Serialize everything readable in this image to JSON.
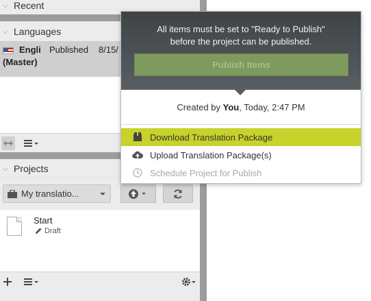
{
  "sections": {
    "recent": "Recent",
    "languages": "Languages",
    "projects": "Projects"
  },
  "language_row": {
    "name": "Engli",
    "master": "(Master)",
    "status": "Published",
    "date": "8/15/"
  },
  "projects_panel": {
    "filter_label": "My translatio..."
  },
  "project_item": {
    "name": "Start",
    "status": "Draft"
  },
  "popover": {
    "message_line1": "All items must be set to \"Ready to Publish\"",
    "message_line2": "before the project can be published.",
    "publish_button": "Publish Items",
    "created_prefix": "Created by ",
    "created_user": "You",
    "created_suffix": ", Today, 2:47 PM",
    "menu": [
      {
        "label": "Download Translation Package"
      },
      {
        "label": "Upload Translation Package(s)"
      },
      {
        "label": "Schedule Project for Publish"
      }
    ]
  },
  "colors": {
    "highlight": "#c7d22a",
    "publish_button": "#7f9a5f",
    "popover_header": "#4a4f52"
  },
  "icons": [
    "chevron-down-icon",
    "flag-us-icon",
    "expand-icon",
    "list-menu-icon",
    "briefcase-icon",
    "upload-circle-icon",
    "refresh-icon",
    "document-icon",
    "pencil-icon",
    "plus-icon",
    "gear-icon",
    "package-icon",
    "cloud-upload-icon",
    "clock-icon"
  ]
}
